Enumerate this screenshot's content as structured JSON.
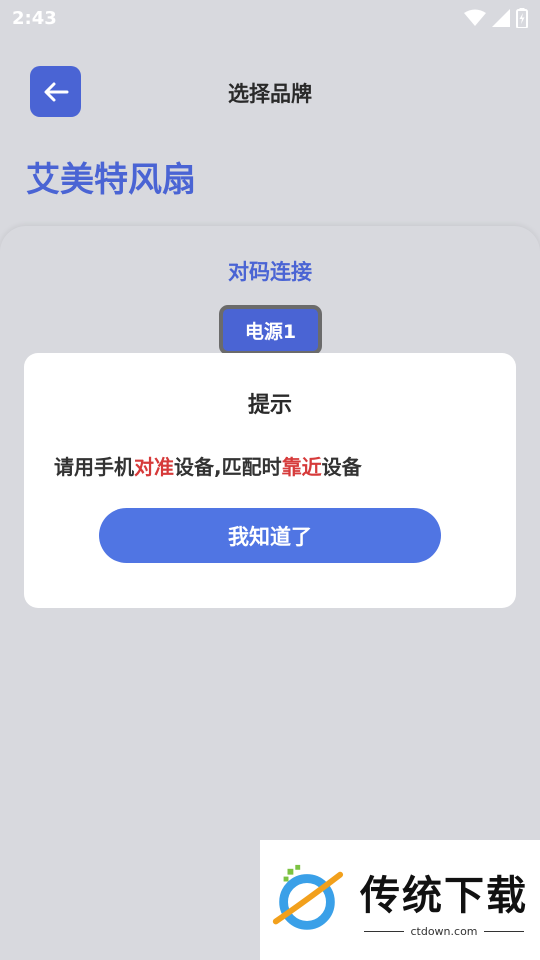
{
  "status_bar": {
    "time": "2:43"
  },
  "header": {
    "title": "选择品牌"
  },
  "brand": {
    "name": "艾美特风扇"
  },
  "panel": {
    "subtitle": "对码连接",
    "power_button": "电源1"
  },
  "dialog": {
    "title": "提示",
    "message_parts": [
      "请用手机",
      "对准",
      "设备,匹配时",
      "靠近",
      "设备"
    ],
    "ok_label": "我知道了"
  },
  "watermark": {
    "brand_text": "传统下载",
    "url": "ctdown.com"
  },
  "colors": {
    "accent": "#4a64d4",
    "highlight": "#d63a3a",
    "button": "#5075e3"
  }
}
